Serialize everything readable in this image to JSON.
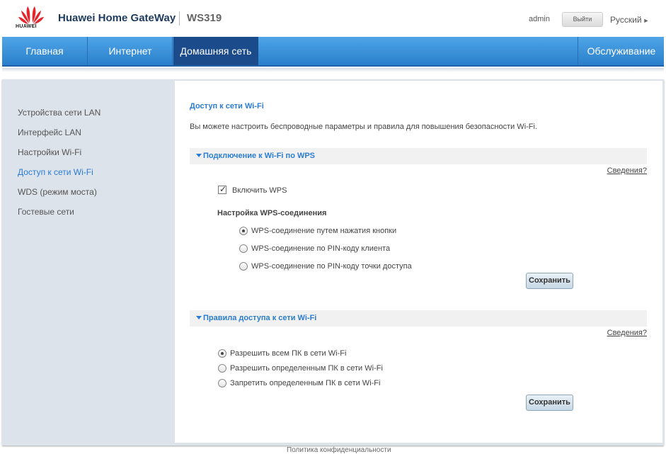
{
  "header": {
    "logo_text": "HUAWEI",
    "brand": "Huawei Home GateWay",
    "model": "WS319",
    "user": "admin",
    "logout_label": "Выйти",
    "language": "Русский"
  },
  "nav": {
    "items": [
      {
        "label": "Главная"
      },
      {
        "label": "Интернет"
      },
      {
        "label": "Домашняя сеть",
        "active": true
      },
      {
        "label": "Обслуживание"
      }
    ]
  },
  "sidebar": {
    "items": [
      {
        "label": "Устройства сети LAN"
      },
      {
        "label": "Интерфейс LAN"
      },
      {
        "label": "Настройки Wi-Fi"
      },
      {
        "label": "Доступ к сети Wi-Fi",
        "active": true
      },
      {
        "label": "WDS (режим моста)"
      },
      {
        "label": "Гостевые сети"
      }
    ]
  },
  "main": {
    "title": "Доступ к сети Wi-Fi",
    "description": "Вы можете настроить беспроводные параметры и правила для повышения безопасности Wi-Fi.",
    "wps_section": {
      "title": "Подключение к Wi-Fi по WPS",
      "details_link": "Сведения?",
      "enable_label": "Включить WPS",
      "enable_checked": true,
      "settings_heading": "Настройка WPS-соединения",
      "options": [
        {
          "label": "WPS-соединение путем нажатия кнопки",
          "checked": true
        },
        {
          "label": "WPS-соединение по PIN-коду клиента",
          "checked": false
        },
        {
          "label": "WPS-соединение по PIN-коду точки доступа",
          "checked": false
        }
      ],
      "save_label": "Сохранить"
    },
    "access_section": {
      "title": "Правила доступа к сети Wi-Fi",
      "details_link": "Сведения?",
      "options": [
        {
          "label": "Разрешить всем ПК в сети Wi-Fi",
          "checked": true
        },
        {
          "label": "Разрешить определенным ПК в сети Wi-Fi",
          "checked": false
        },
        {
          "label": "Запретить определенным ПК в сети Wi-Fi",
          "checked": false
        }
      ],
      "save_label": "Сохранить"
    }
  },
  "footer": {
    "privacy": "Политика конфиденциальности"
  },
  "colors": {
    "accent": "#2b7dd2",
    "nav_active": "#1b4b8a",
    "sidebar_bg": "#dce3ea"
  }
}
